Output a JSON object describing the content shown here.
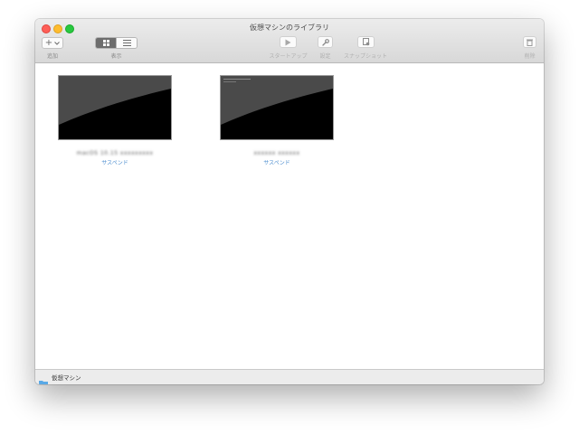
{
  "window": {
    "title": "仮想マシンのライブラリ"
  },
  "toolbar": {
    "add": {
      "symbol": "+",
      "label": "追加",
      "icon": "plus-chevron-icon"
    },
    "view": {
      "label": "表示",
      "selected": "grid",
      "icons": [
        "grid-icon",
        "list-icon"
      ]
    },
    "startup": {
      "label": "スタートアップ",
      "icon": "play-icon"
    },
    "settings": {
      "label": "設定",
      "icon": "wrench-icon"
    },
    "snapshot": {
      "label": "スナップショット",
      "icon": "snapshot-icon"
    },
    "delete": {
      "label": "削除",
      "icon": "trash-icon"
    }
  },
  "vms": [
    {
      "name": "macOS 10.15 xxxxxxxxx",
      "status": "サスペンド"
    },
    {
      "name": "xxxxxx xxxxxx",
      "status": "サスペンド"
    }
  ],
  "statusbar": {
    "label": "仮想マシン",
    "icon": "folder-icon"
  },
  "colors": {
    "status_link": "#4f8fd0",
    "folder": "#5aa9e6"
  }
}
